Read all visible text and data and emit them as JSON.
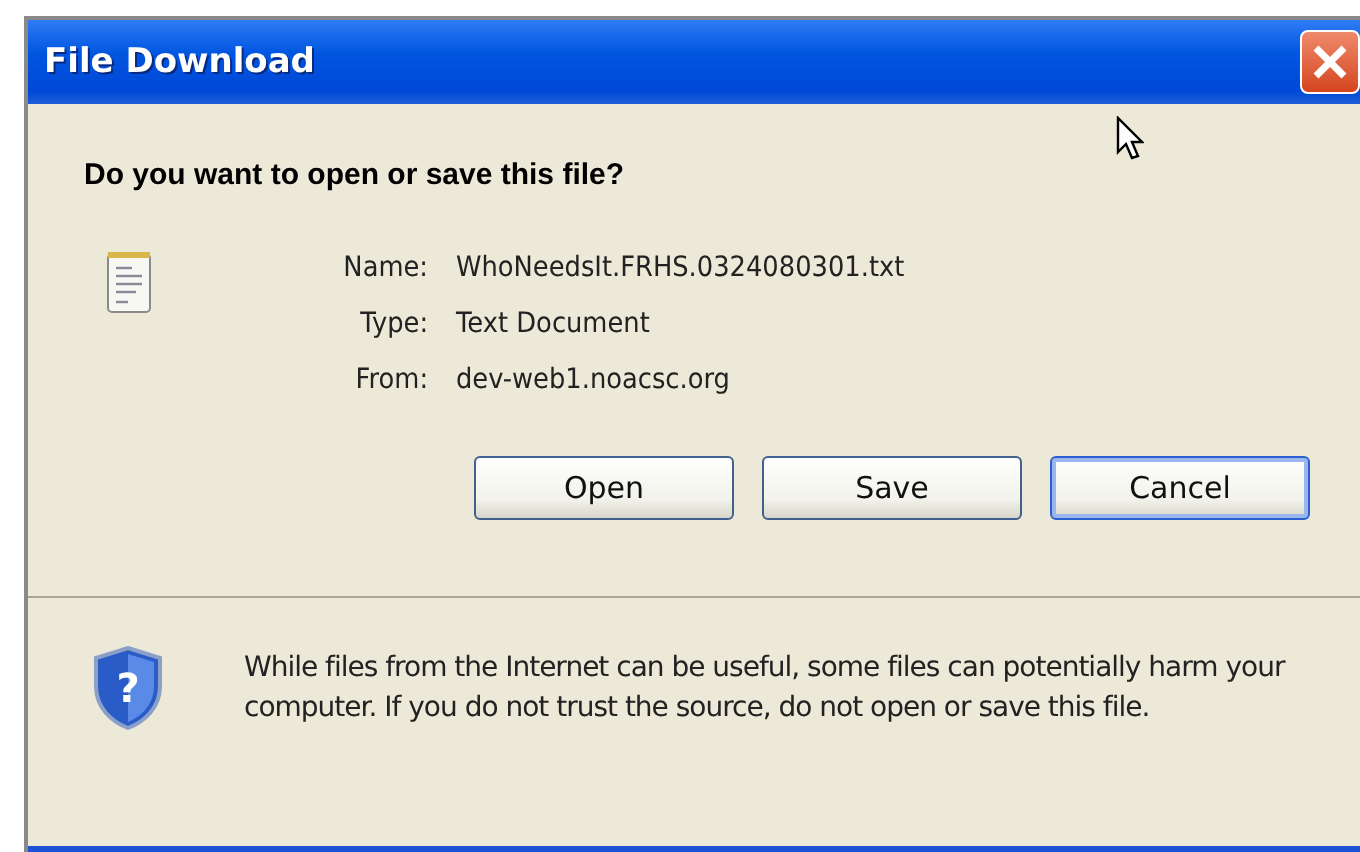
{
  "window": {
    "title": "File Download"
  },
  "question": "Do you want to open or save this file?",
  "details": [
    {
      "label": "Name:",
      "value": "WhoNeedsIt.FRHS.0324080301.txt"
    },
    {
      "label": "Type:",
      "value": "Text Document"
    },
    {
      "label": "From:",
      "value": "dev-web1.noacsc.org"
    }
  ],
  "buttons": [
    {
      "label": "Open",
      "default": false
    },
    {
      "label": "Save",
      "default": false
    },
    {
      "label": "Cancel",
      "default": true
    }
  ],
  "warning": {
    "glyph": "?",
    "text": "While files from the Internet can be useful, some files can potentially harm your computer. If you do not trust the source, do not open or save this file."
  }
}
